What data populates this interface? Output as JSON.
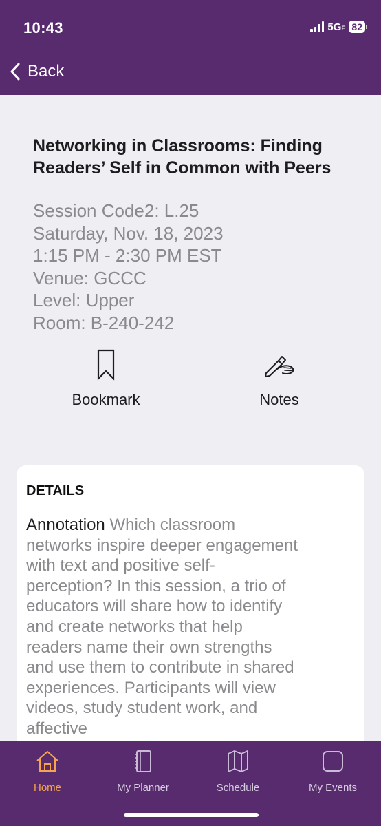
{
  "status_bar": {
    "time": "10:43",
    "network": "5G",
    "network_suffix": "E",
    "battery": "82"
  },
  "nav": {
    "back_label": "Back"
  },
  "session": {
    "title": "Networking in Classrooms: Finding Readers’ Self in Common with Peers",
    "session_code": "Session Code2: L.25",
    "date": "Saturday, Nov. 18, 2023",
    "time": "1:15 PM - 2:30 PM EST",
    "venue": "Venue: GCCC",
    "level": "Level: Upper",
    "room": "Room: B-240-242"
  },
  "actions": {
    "bookmark_label": "Bookmark",
    "bookmark_icon": "bookmark-icon",
    "notes_label": "Notes",
    "notes_icon": "hand-writing-icon"
  },
  "details": {
    "heading": "DETAILS",
    "lead": "Annotation",
    "text": "Which classroom networks inspire deeper engagement with text and positive self-perception? In this session, a trio of educators will share how to identify and create networks that help readers name their own strengths and use them to contribute in shared experiences. Participants will view videos, study student work, and affective"
  },
  "tabs": [
    {
      "label": "Home",
      "icon": "home-icon",
      "active": true
    },
    {
      "label": "My Planner",
      "icon": "planner-icon",
      "active": false
    },
    {
      "label": "Schedule",
      "icon": "map-icon",
      "active": false
    },
    {
      "label": "My Events",
      "icon": "events-icon",
      "active": false
    }
  ],
  "colors": {
    "brand_purple": "#572b6e",
    "active_tab": "#f4a44c",
    "background": "#efeef3",
    "muted_text": "#8a8a8e"
  }
}
